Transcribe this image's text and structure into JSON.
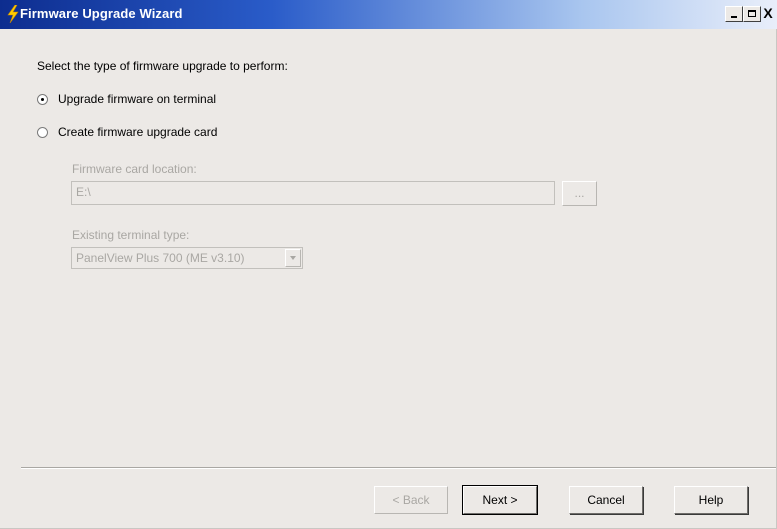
{
  "window": {
    "title": "Firmware Upgrade Wizard",
    "controls": {
      "minimize": "minimize",
      "maximize": "maximize",
      "close": "X"
    }
  },
  "main": {
    "prompt": "Select the type of firmware upgrade to perform:",
    "options": [
      {
        "label": "Upgrade firmware on terminal",
        "selected": true
      },
      {
        "label": "Create firmware upgrade card",
        "selected": false
      }
    ],
    "card_location": {
      "label": "Firmware card location:",
      "value": "E:\\",
      "browse_label": "..."
    },
    "terminal_type": {
      "label": "Existing terminal type:",
      "value": "PanelView Plus 700  (ME v3.10)"
    }
  },
  "footer": {
    "back_label": "< Back",
    "next_label": "Next >",
    "cancel_label": "Cancel",
    "help_label": "Help"
  },
  "colors": {
    "titlebar_start": "#0d2d8f",
    "titlebar_end": "#e9eefa",
    "dialog_bg": "#ece9e6",
    "disabled_text": "#a9a7a3",
    "lightning": "#ffcc00"
  }
}
